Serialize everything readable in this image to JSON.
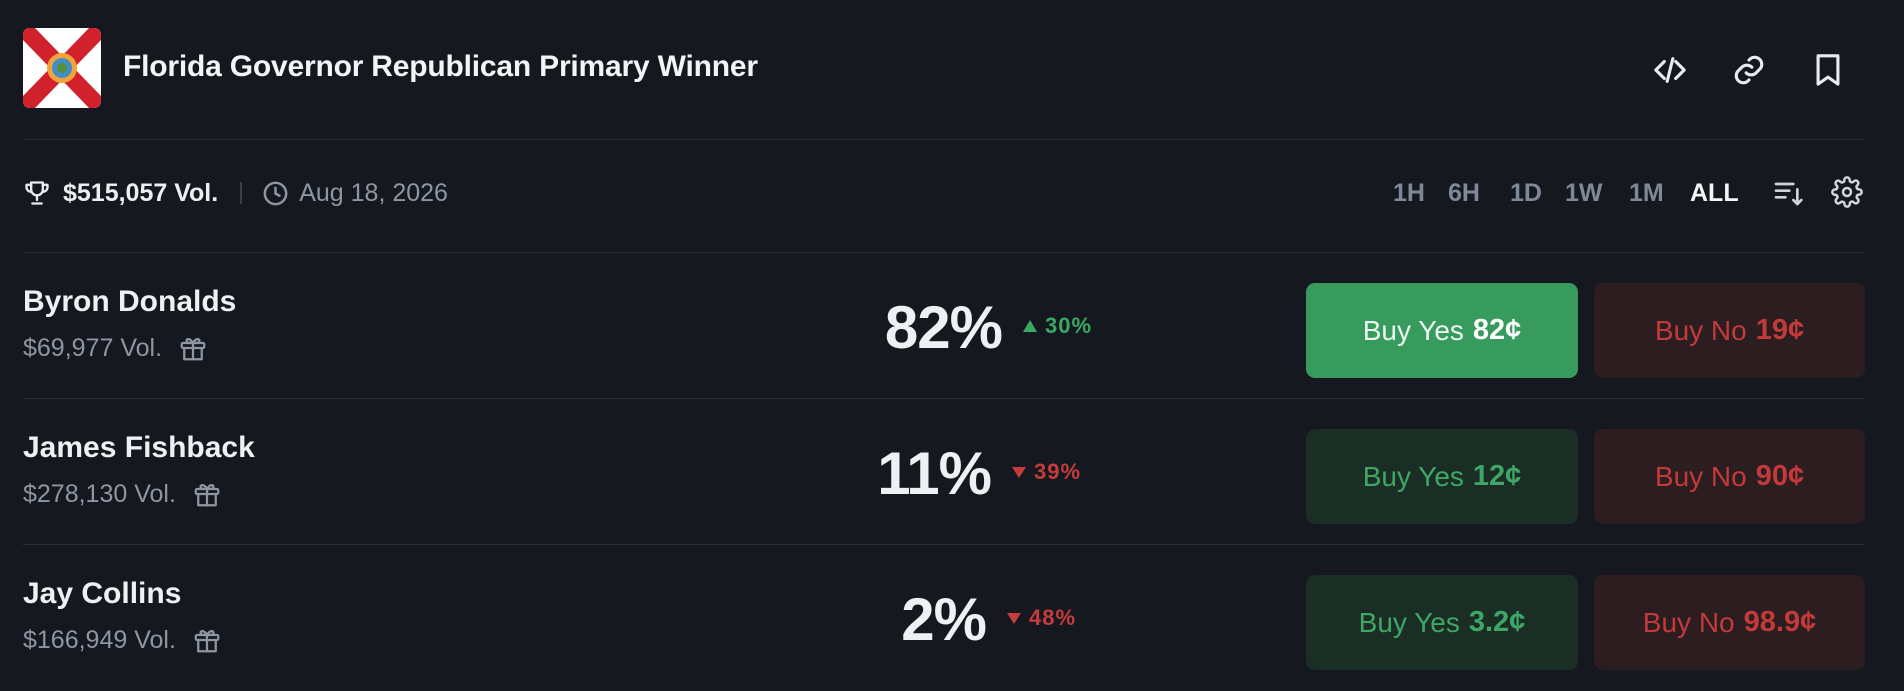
{
  "market": {
    "title": "Florida Governor Republican Primary Winner",
    "volume": "$515,057 Vol.",
    "end_date": "Aug 18, 2026",
    "flag_icon": "florida-flag-icon"
  },
  "header_actions": [
    {
      "name": "embed-button",
      "icon": "code-icon"
    },
    {
      "name": "copy-link-button",
      "icon": "link-icon"
    },
    {
      "name": "bookmark-button",
      "icon": "bookmark-icon"
    }
  ],
  "time_ranges": [
    "1H",
    "6H",
    "1D",
    "1W",
    "1M",
    "ALL"
  ],
  "active_range": "ALL",
  "colors": {
    "background": "#15181e",
    "yes_strong": "#369b5d",
    "yes_dim_bg": "#1a2e25",
    "no_dim_bg": "#2c1d20",
    "up": "#3aa865",
    "down": "#c43c3c"
  },
  "outcomes": [
    {
      "name": "Byron Donalds",
      "volume": "$69,977 Vol.",
      "probability": "82%",
      "change": "30%",
      "direction": "up",
      "yes_label": "Buy Yes",
      "yes_price": "82¢",
      "no_label": "Buy No",
      "no_price": "19¢"
    },
    {
      "name": "James Fishback",
      "volume": "$278,130 Vol.",
      "probability": "11%",
      "change": "39%",
      "direction": "down",
      "yes_label": "Buy Yes",
      "yes_price": "12¢",
      "no_label": "Buy No",
      "no_price": "90¢"
    },
    {
      "name": "Jay Collins",
      "volume": "$166,949 Vol.",
      "probability": "2%",
      "change": "48%",
      "direction": "down",
      "yes_label": "Buy Yes",
      "yes_price": "3.2¢",
      "no_label": "Buy No",
      "no_price": "98.9¢"
    }
  ]
}
